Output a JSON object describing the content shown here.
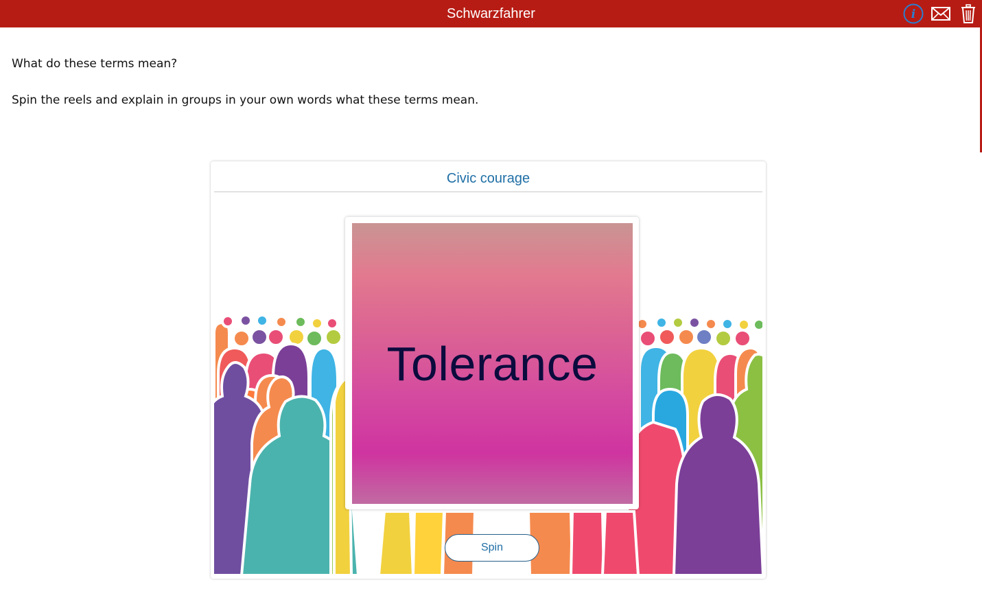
{
  "app": {
    "title": "Schwarzfahrer"
  },
  "toolbar": {
    "icons": [
      "info-icon",
      "mail-icon",
      "trash-icon"
    ]
  },
  "content": {
    "question": "What do these terms mean?",
    "instruction": "Spin the reels and explain in groups in your own words what these terms mean."
  },
  "card": {
    "title": "Civic courage",
    "reel_term": "Tolerance",
    "spin_label": "Spin"
  },
  "colors": {
    "header_bg": "#b71c14",
    "accent_text": "#1f6fa6",
    "term_text": "#0b0b3d"
  }
}
